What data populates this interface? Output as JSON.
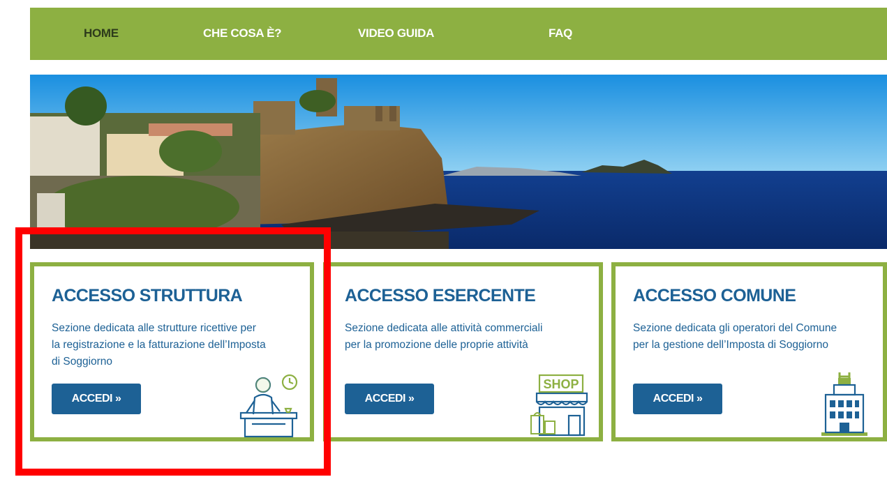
{
  "nav": {
    "items": [
      {
        "label": "HOME",
        "active": true
      },
      {
        "label": "CHE COSA È?",
        "active": false
      },
      {
        "label": "VIDEO GUIDA",
        "active": false
      },
      {
        "label": "FAQ",
        "active": false
      }
    ]
  },
  "cards": [
    {
      "title": "ACCESSO STRUTTURA",
      "desc_lines": [
        "Sezione dedicata alle strutture ricettive per",
        "la registrazione e la fatturazione dell’Imposta",
        "di Soggiorno"
      ],
      "button": "ACCEDI »",
      "icon": "receptionist-icon"
    },
    {
      "title": "ACCESSO ESERCENTE",
      "desc_lines": [
        "Sezione dedicata alle attività commerciali",
        "per la promozione delle proprie attività"
      ],
      "button": "ACCEDI »",
      "icon": "shop-icon",
      "icon_text": "SHOP"
    },
    {
      "title": "ACCESSO COMUNE",
      "desc_lines": [
        "Sezione dedicata gli operatori del Comune",
        "per la gestione dell’Imposta di Soggiorno"
      ],
      "button": "ACCEDI »",
      "icon": "town-hall-icon"
    }
  ],
  "colors": {
    "nav_green": "#8db042",
    "brand_blue": "#1d6195",
    "highlight_red": "#ff0000"
  }
}
